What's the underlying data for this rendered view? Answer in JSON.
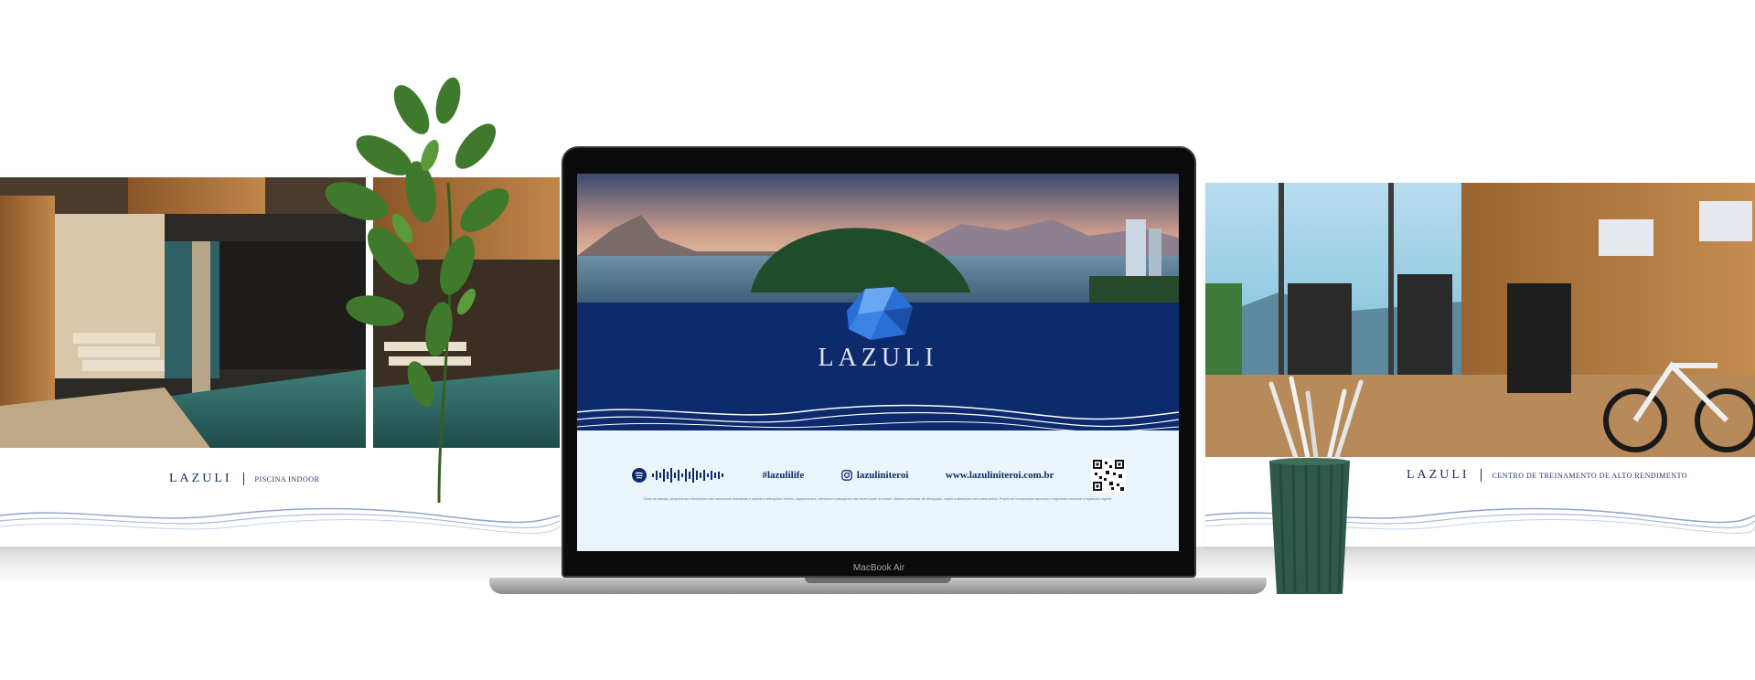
{
  "left_panel": {
    "brand": "LAZULI",
    "caption": "PISCINA INDOOR",
    "photo_subject": "indoor-pool-render"
  },
  "right_panel": {
    "brand": "LAZULI",
    "caption": "CENTRO DE TREINAMENTO DE ALTO RENDIMENTO",
    "photo_subject": "gym-render"
  },
  "laptop": {
    "model_label": "MacBook Air",
    "screen": {
      "hero_subject": "niteroi-bay-landscape",
      "logo": "LAZULI",
      "spotify_icon": "spotify-icon",
      "soundwave_icon": "spotify-code-icon",
      "hashtag": "#lazulilife",
      "instagram_icon": "instagram-icon",
      "instagram_handle": "lazuliniteroi",
      "website": "www.lazuliniteroi.com.br",
      "qr_icon": "qr-code-icon",
      "fine_print": "Todas as plantas, perspectivas e ilustrações são meramente ilustrativas e sujeitas a alterações. Móveis, equipamentos, utensílios e paisagismo não fazem parte do imóvel. Material preliminar de divulgação, sujeito a alterações sem aviso prévio. Projeto de incorporação aprovado e registrado conforme a legislação vigente."
    }
  },
  "colors": {
    "navy": "#0d2a6d",
    "light_blue": "#e9f4fb",
    "wave_blue": "#8fa6cc",
    "cup_green": "#2f5a4a",
    "plant_green": "#3f7a2c"
  }
}
